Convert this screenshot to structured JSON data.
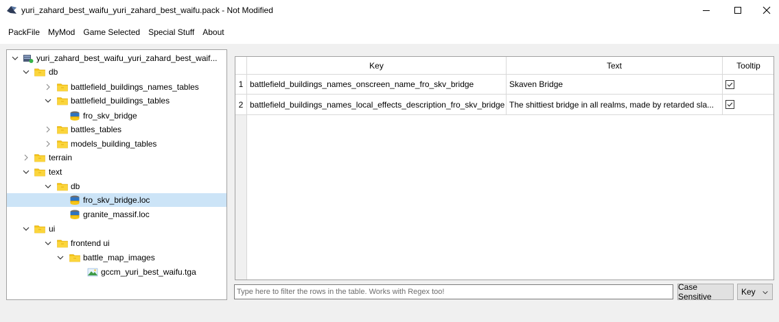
{
  "window": {
    "title": "yuri_zahard_best_waifu_yuri_zahard_best_waifu.pack - Not Modified"
  },
  "menu": {
    "items": [
      "PackFile",
      "MyMod",
      "Game Selected",
      "Special Stuff",
      "About"
    ]
  },
  "tree": {
    "nodes": [
      {
        "label": "yuri_zahard_best_waifu_yuri_zahard_best_waif...",
        "icon": "pack-file-icon",
        "expanded": true
      },
      {
        "label": "db",
        "icon": "folder-icon",
        "expanded": true
      },
      {
        "label": "battlefield_buildings_names_tables",
        "icon": "folder-icon",
        "expanded": false
      },
      {
        "label": "battlefield_buildings_tables",
        "icon": "folder-icon",
        "expanded": true
      },
      {
        "label": "fro_skv_bridge",
        "icon": "database-icon"
      },
      {
        "label": "battles_tables",
        "icon": "folder-icon",
        "expanded": false
      },
      {
        "label": "models_building_tables",
        "icon": "folder-icon",
        "expanded": false
      },
      {
        "label": "terrain",
        "icon": "folder-icon",
        "expanded": false
      },
      {
        "label": "text",
        "icon": "folder-icon",
        "expanded": true
      },
      {
        "label": "db",
        "icon": "folder-icon",
        "expanded": true
      },
      {
        "label": "fro_skv_bridge.loc",
        "icon": "database-icon",
        "selected": true
      },
      {
        "label": "granite_massif.loc",
        "icon": "database-icon"
      },
      {
        "label": "ui",
        "icon": "folder-icon",
        "expanded": true
      },
      {
        "label": "frontend ui",
        "icon": "folder-icon",
        "expanded": true
      },
      {
        "label": "battle_map_images",
        "icon": "folder-icon",
        "expanded": true
      },
      {
        "label": "gccm_yuri_best_waifu.tga",
        "icon": "image-file-icon"
      }
    ]
  },
  "table": {
    "columns": [
      "Key",
      "Text",
      "Tooltip"
    ],
    "rows": [
      {
        "num": "1",
        "key": "battlefield_buildings_names_onscreen_name_fro_skv_bridge",
        "text": "Skaven Bridge",
        "tooltip": true
      },
      {
        "num": "2",
        "key": "battlefield_buildings_names_local_effects_description_fro_skv_bridge",
        "text": "The shittiest bridge in all realms, made by retarded sla...",
        "tooltip": true
      }
    ]
  },
  "filter": {
    "placeholder": "Type here to filter the rows in the table. Works with Regex too!",
    "value": "",
    "case_sensitive_label": "Case Sensitive",
    "column_selected": "Key"
  },
  "colors": {
    "selection": "#cce4f7",
    "folder": "#f5c518",
    "border": "#a0a0a0"
  }
}
